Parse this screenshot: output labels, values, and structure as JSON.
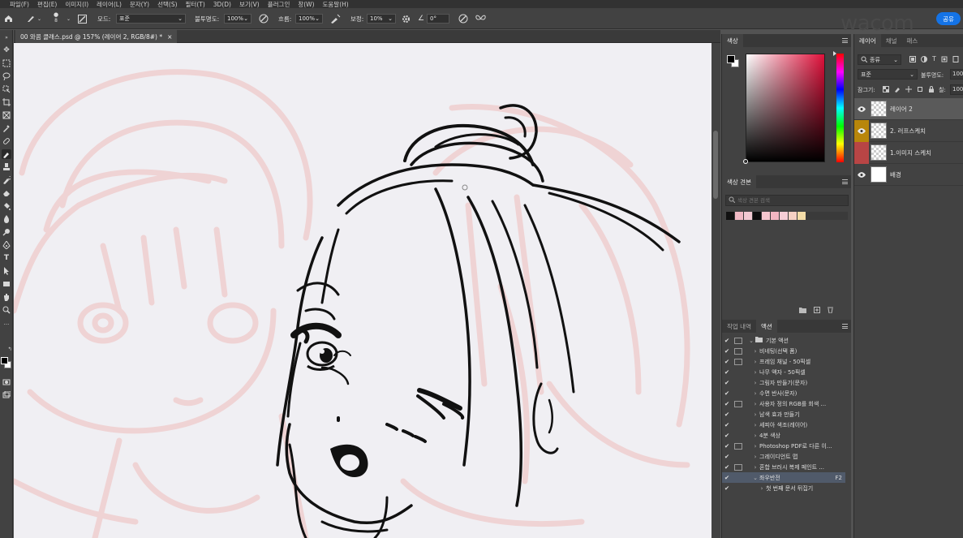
{
  "menu": [
    "파일(F)",
    "편집(E)",
    "이미지(I)",
    "레이어(L)",
    "문자(Y)",
    "선택(S)",
    "필터(T)",
    "3D(D)",
    "보기(V)",
    "플러그인",
    "창(W)",
    "도움말(H)"
  ],
  "options": {
    "mode_label": "모드:",
    "mode_value": "표준",
    "opacity_label": "불투명도:",
    "opacity_value": "100%",
    "flow_label": "흐름:",
    "flow_value": "100%",
    "smoothing_label": "보정:",
    "smoothing_value": "10%",
    "angle_label": "∠",
    "angle_value": "0°",
    "brush_size": "8"
  },
  "share_label": "공유",
  "brand": "wacom",
  "document_tab": {
    "title": "00 와콤 클래스.psd @ 157% (레이어 2, RGB/8#) *",
    "close": "×"
  },
  "color_panel": {
    "tab": "색상",
    "picked_hue_color": "#e0103a"
  },
  "swatches_panel": {
    "tab": "색상 견본",
    "search_placeholder": "색상 견본 검색",
    "colors": [
      "#111111",
      "#f0b9c4",
      "#f1c9d2",
      "#0d0d0d",
      "#f5c7cf",
      "#f2b6c2",
      "#f6cdd6",
      "#f6d1c4",
      "#f3dca7"
    ]
  },
  "actions_panel": {
    "tabs": [
      "작업 내역",
      "액션"
    ],
    "items": [
      {
        "label": "기본 액션",
        "kind": "folder",
        "expanded": true,
        "dialog": true
      },
      {
        "label": "비네팅(선택 폼)",
        "dialog": true
      },
      {
        "label": "프레임 채널 - 50픽셀",
        "dialog": true
      },
      {
        "label": "나무 액자 - 50픽셀",
        "dialog": false
      },
      {
        "label": "그림자 만들기(문자)",
        "dialog": false
      },
      {
        "label": "수면 반사(문자)",
        "dialog": false
      },
      {
        "label": "사용자 정의 RGB를 회색 ...",
        "dialog": true
      },
      {
        "label": "남색 효과 만들기",
        "dialog": false
      },
      {
        "label": "세피아 색조(레이어)",
        "dialog": false
      },
      {
        "label": "4분 색상",
        "dialog": false
      },
      {
        "label": "Photoshop PDF로 다른 이...",
        "dialog": true
      },
      {
        "label": "그레이디언트 맵",
        "dialog": false
      },
      {
        "label": "혼합 브러시 복제 페인트 ...",
        "dialog": true
      },
      {
        "label": "좌우반전",
        "dialog": false,
        "shortcut": "F2",
        "expanded": true,
        "selected": true
      },
      {
        "label": "첫 번째 문서 뒤집기",
        "dialog": false,
        "child": true
      }
    ]
  },
  "layers_panel": {
    "tabs": [
      "레이어",
      "채널",
      "패스"
    ],
    "filter_label": "종류",
    "blend_mode": "표준",
    "opacity_label": "불투명도:",
    "opacity_value": "100",
    "lock_label": "잠그기:",
    "fill_label": "칠:",
    "fill_value": "100",
    "layers": [
      {
        "name": "레이어 2",
        "visible": true,
        "selected": true,
        "color_tag": "",
        "thumb": "transparent"
      },
      {
        "name": "2. 러프스케치",
        "visible": true,
        "selected": false,
        "color_tag": "#b8860b",
        "thumb": "transparent"
      },
      {
        "name": "1.이미지 스케치",
        "visible": false,
        "selected": false,
        "color_tag": "#b84545",
        "thumb": "transparent"
      },
      {
        "name": "배경",
        "visible": true,
        "selected": false,
        "color_tag": "",
        "thumb": "white"
      }
    ]
  }
}
